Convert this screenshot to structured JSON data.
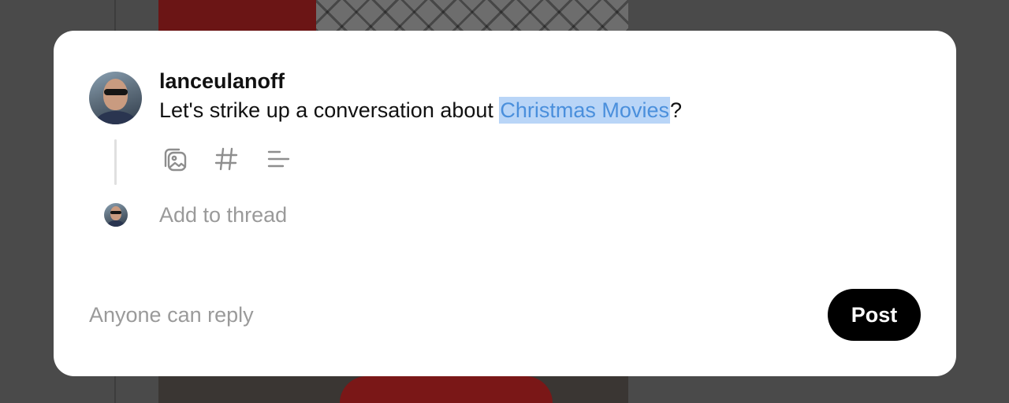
{
  "composer": {
    "username": "lanceulanoff",
    "text_before": "Let's strike up a conversation about ",
    "hashtag": "Christmas Movies",
    "text_after": "?",
    "add_to_thread_placeholder": "Add to thread",
    "reply_setting": "Anyone can reply",
    "post_label": "Post"
  },
  "icons": {
    "attach_media": "image-gallery-icon",
    "hashtag": "hashtag-icon",
    "poll": "poll-lines-icon"
  },
  "colors": {
    "hashtag_text": "#4a8fdc",
    "hashtag_highlight": "#b9d5f7",
    "post_button": "#000000",
    "placeholder_gray": "#9a9a9a"
  }
}
